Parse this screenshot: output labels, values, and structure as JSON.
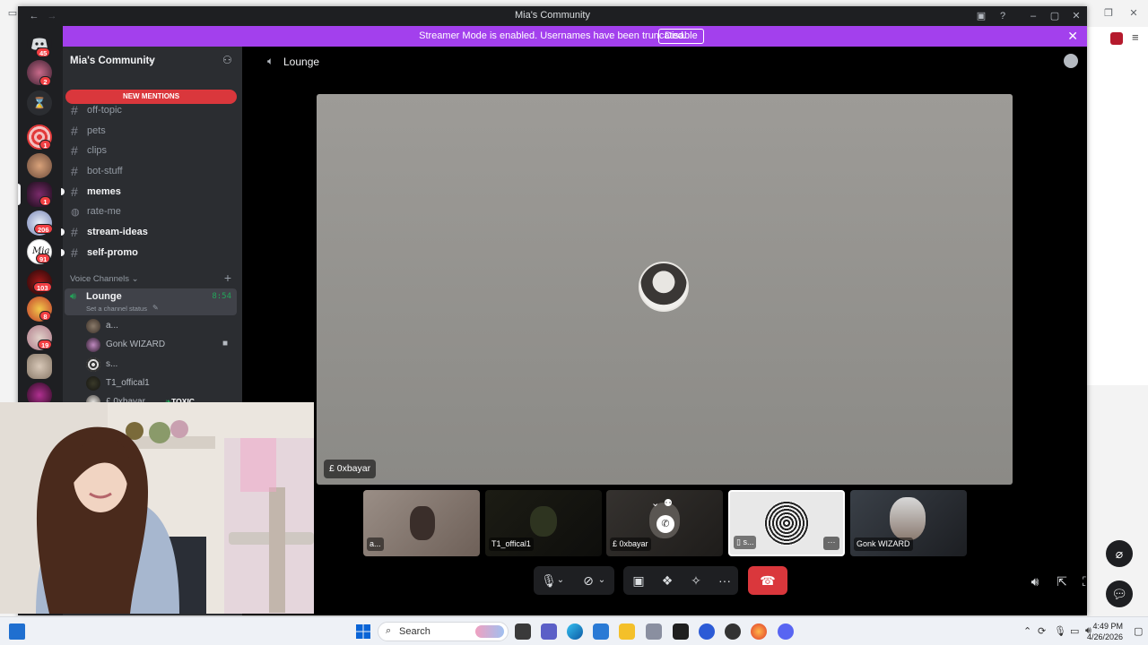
{
  "window": {
    "title": "Mia's Community"
  },
  "banner": {
    "message": "Streamer Mode is enabled. Usernames have been truncated.",
    "disable_label": "Disable"
  },
  "servers": [
    {
      "badge": "45"
    },
    {
      "badge": "2"
    },
    {
      "badge": ""
    },
    {
      "badge": "1"
    },
    {
      "badge": ""
    },
    {
      "badge": "1"
    },
    {
      "badge": "206"
    },
    {
      "badge": "91"
    },
    {
      "badge": "103"
    },
    {
      "badge": "8"
    },
    {
      "badge": "19"
    },
    {
      "badge": ""
    },
    {
      "badge": ""
    }
  ],
  "sidebar": {
    "guild_name": "Mia's Community",
    "new_mentions": "NEW MENTIONS",
    "channels": [
      {
        "name": "off-topic",
        "unread": false
      },
      {
        "name": "pets",
        "unread": false
      },
      {
        "name": "clips",
        "unread": false
      },
      {
        "name": "bot-stuff",
        "unread": false
      },
      {
        "name": "memes",
        "unread": true
      },
      {
        "name": "rate-me",
        "unread": false
      },
      {
        "name": "stream-ideas",
        "unread": true
      },
      {
        "name": "self-promo",
        "unread": true
      }
    ],
    "voice_section": "Voice Channels",
    "voice_channel": {
      "name": "Lounge",
      "timer": "8:54",
      "status": "Set a channel status"
    },
    "voice_users": [
      {
        "name": "a..."
      },
      {
        "name": "Gonk WIZARD"
      },
      {
        "name": "s..."
      },
      {
        "name": "T1_offical1"
      },
      {
        "name": "£ 0xbayar",
        "tag": "TOXIC"
      }
    ]
  },
  "main": {
    "channel_title": "Lounge",
    "focused_user": "£ 0xbayar",
    "tiles": [
      {
        "name": "a..."
      },
      {
        "name": "T1_offical1"
      },
      {
        "name": "£ 0xbayar"
      },
      {
        "name": "s..."
      },
      {
        "name": "Gonk WIZARD"
      }
    ]
  },
  "taskbar": {
    "search": "Search",
    "time": "4:49 PM",
    "date": "4/26/2026"
  },
  "colors": {
    "banner": "#a340ed",
    "hangup": "#da373c",
    "mentions": "#da373c",
    "rail": "#1e1f22",
    "sidebar": "#2b2d31"
  }
}
